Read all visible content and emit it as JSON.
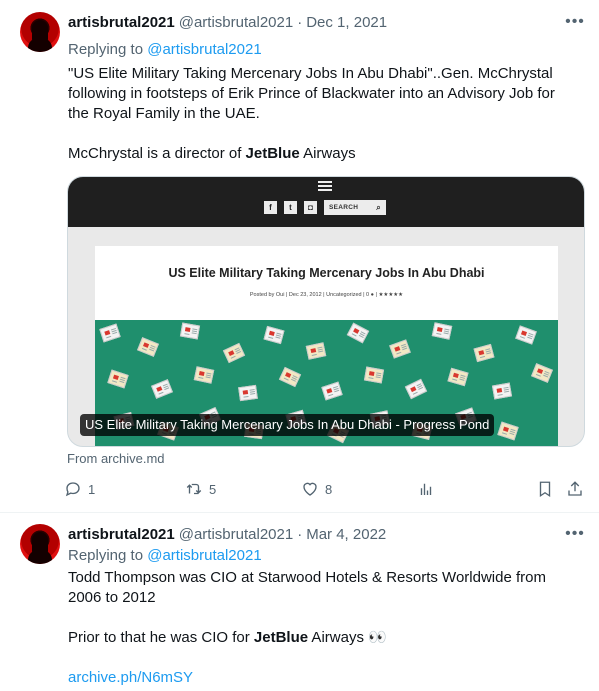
{
  "tweets": [
    {
      "user": {
        "name": "artisbrutal2021",
        "handle": "@artisbrutal2021"
      },
      "date": "Dec 1, 2021",
      "replying_prefix": "Replying to",
      "replying_to": "@artisbrutal2021",
      "text_lines": [
        "\"US Elite Military Taking Mercenary Jobs In Abu Dhabi\"..Gen. McChrystal",
        "following in footsteps of Erik Prince of Blackwater into an Advisory Job for",
        "the Royal Family in the UAE."
      ],
      "text2_prefix": "McChrystal is a director of ",
      "text2_bold": "JetBlue",
      "text2_suffix": " Airways",
      "card": {
        "search_label": "SEARCH",
        "social_icons": [
          "f",
          "t",
          "ig"
        ],
        "article_title": "US Elite Military Taking Mercenary Jobs In Abu Dhabi",
        "article_meta": "Posted by Oui | Dec 23, 2012 | Uncategorized | 0 ● | ★★★★★",
        "caption": "US Elite Military Taking Mercenary Jobs In Abu Dhabi - Progress Pond",
        "source": "From archive.md"
      },
      "actions": {
        "replies": "1",
        "retweets": "5",
        "likes": "8"
      }
    },
    {
      "user": {
        "name": "artisbrutal2021",
        "handle": "@artisbrutal2021"
      },
      "date": "Mar 4, 2022",
      "replying_prefix": "Replying to",
      "replying_to": "@artisbrutal2021",
      "text_lines": [
        "Todd Thompson was CIO at Starwood Hotels & Resorts Worldwide from",
        "2006 to 2012"
      ],
      "text2_prefix": "Prior to that he was CIO for ",
      "text2_bold": "JetBlue",
      "text2_suffix": " Airways 👀",
      "link": "archive.ph/N6mSY"
    }
  ],
  "icons": {
    "more": "more-icon",
    "reply": "reply-icon",
    "retweet": "retweet-icon",
    "like": "heart-icon",
    "views": "views-icon",
    "bookmark": "bookmark-icon",
    "share": "share-icon"
  },
  "colors": {
    "link": "#1d9bf0",
    "muted": "#536471",
    "text": "#0f1419",
    "card_green": "#1f8f6d"
  }
}
